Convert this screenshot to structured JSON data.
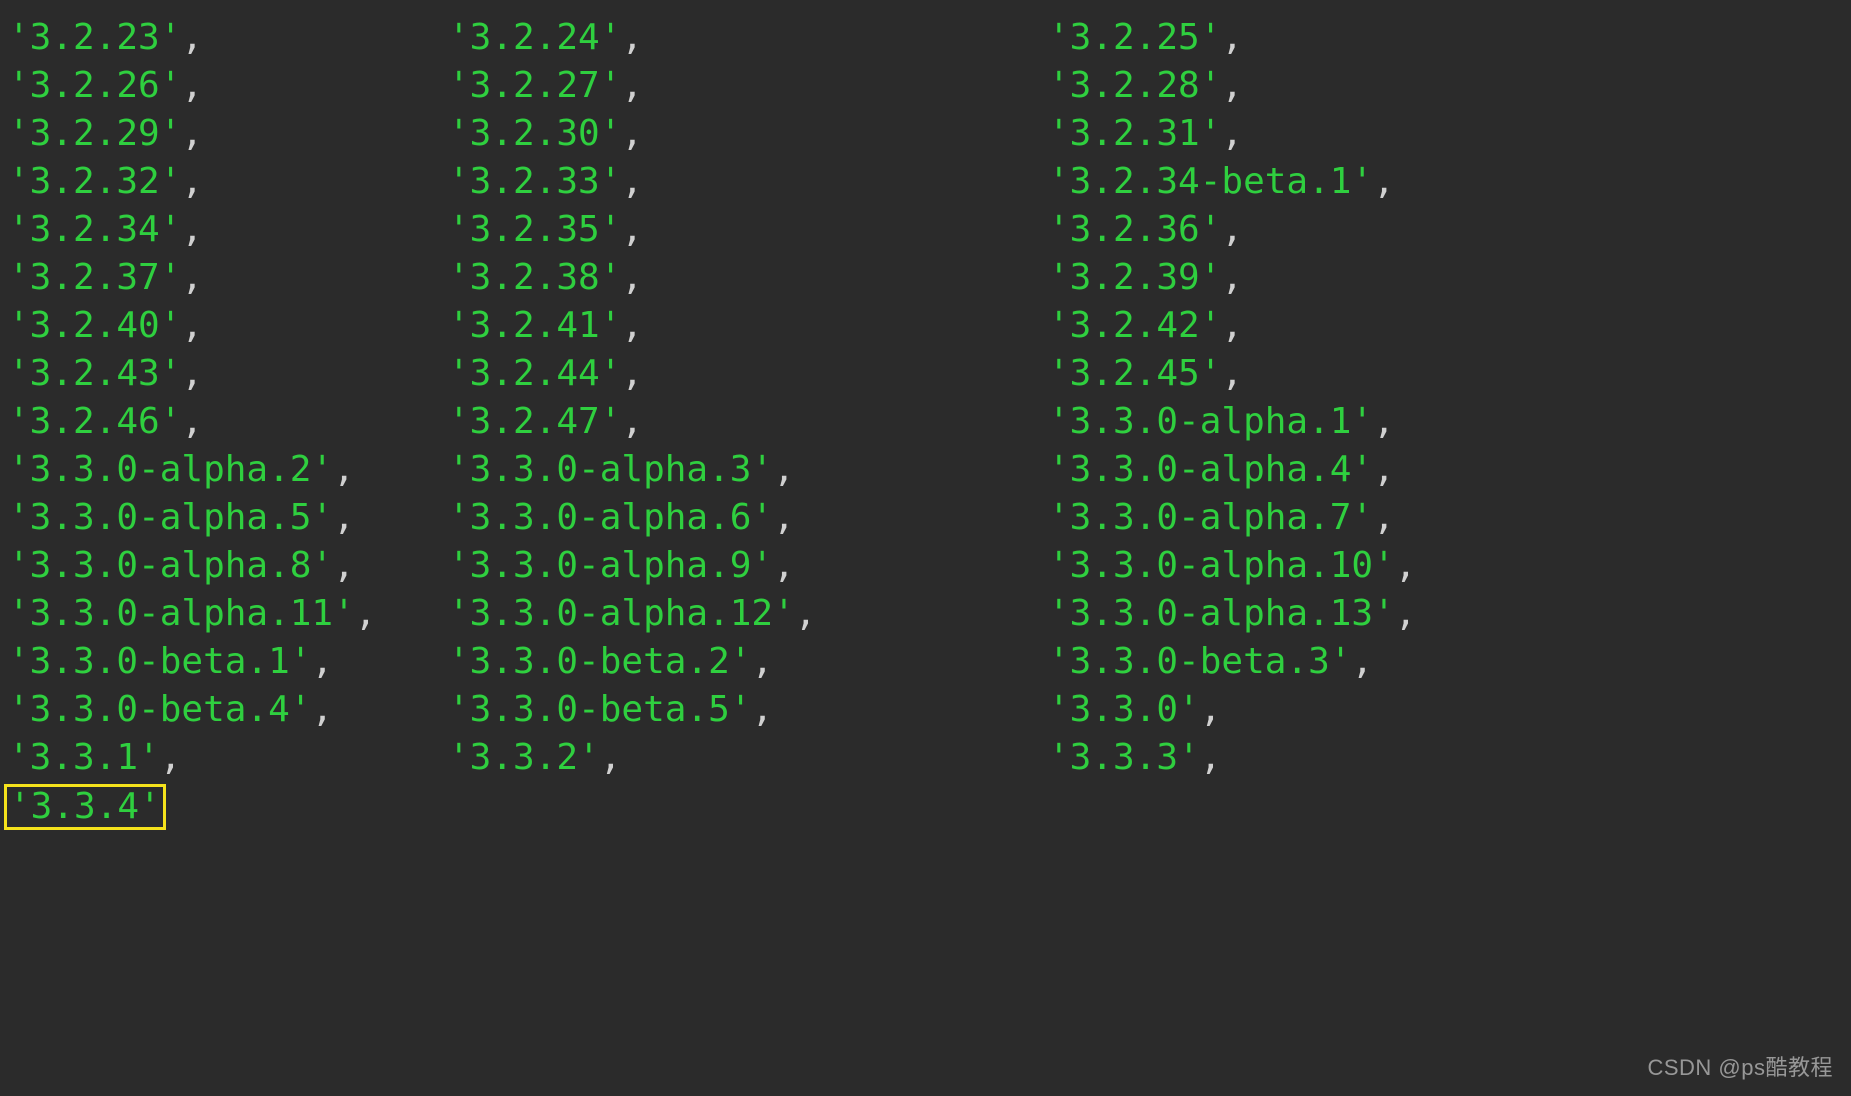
{
  "versions": [
    [
      "3.2.23",
      "3.2.24",
      "3.2.25"
    ],
    [
      "3.2.26",
      "3.2.27",
      "3.2.28"
    ],
    [
      "3.2.29",
      "3.2.30",
      "3.2.31"
    ],
    [
      "3.2.32",
      "3.2.33",
      "3.2.34-beta.1"
    ],
    [
      "3.2.34",
      "3.2.35",
      "3.2.36"
    ],
    [
      "3.2.37",
      "3.2.38",
      "3.2.39"
    ],
    [
      "3.2.40",
      "3.2.41",
      "3.2.42"
    ],
    [
      "3.2.43",
      "3.2.44",
      "3.2.45"
    ],
    [
      "3.2.46",
      "3.2.47",
      "3.3.0-alpha.1"
    ],
    [
      "3.3.0-alpha.2",
      "3.3.0-alpha.3",
      "3.3.0-alpha.4"
    ],
    [
      "3.3.0-alpha.5",
      "3.3.0-alpha.6",
      "3.3.0-alpha.7"
    ],
    [
      "3.3.0-alpha.8",
      "3.3.0-alpha.9",
      "3.3.0-alpha.10"
    ],
    [
      "3.3.0-alpha.11",
      "3.3.0-alpha.12",
      "3.3.0-alpha.13"
    ],
    [
      "3.3.0-beta.1",
      "3.3.0-beta.2",
      "3.3.0-beta.3"
    ],
    [
      "3.3.0-beta.4",
      "3.3.0-beta.5",
      "3.3.0"
    ],
    [
      "3.3.1",
      "3.3.2",
      "3.3.3"
    ]
  ],
  "lastRow": {
    "value": "3.3.4",
    "highlighted": true
  },
  "watermark": "CSDN @ps酷教程",
  "colors": {
    "background": "#2b2b2b",
    "string": "#2fcf3f",
    "comma": "#d0d0d0",
    "highlightBorder": "#f5e21c"
  }
}
